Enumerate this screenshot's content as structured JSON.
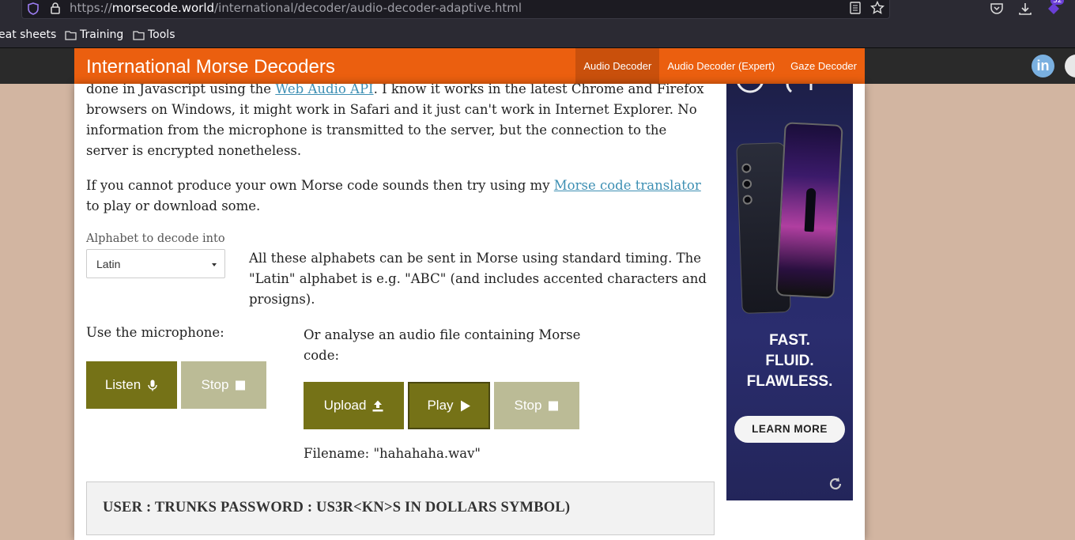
{
  "browser": {
    "url_prefix": "https://",
    "url_host": "morsecode.world",
    "url_path": "/international/decoder/audio-decoder-adaptive.html",
    "extensions_badge": "32",
    "bookmarks": [
      "eat sheets",
      "Training",
      "Tools"
    ]
  },
  "site": {
    "title": "International Morse Decoders",
    "nav": [
      "Audio Decoder",
      "Audio Decoder (Expert)",
      "Gaze Decoder"
    ],
    "social": {
      "linkedin": "in"
    }
  },
  "content": {
    "p1_before": "done in Javascript using the ",
    "p1_link": "Web Audio API",
    "p1_after": ". I know it works in the latest Chrome and Firefox browsers on Windows, it might work in Safari and it just can't work in Internet Explorer. No information from the microphone is transmitted to the server, but the connection to the server is encrypted nonetheless.",
    "p2_before": "If you cannot produce your own Morse code sounds then try using my ",
    "p2_link": "Morse code translator",
    "p2_after": " to play or download some.",
    "alphabet_label": "Alphabet to decode into",
    "alphabet_value": "Latin",
    "alphabet_desc": "All these alphabets can be sent in Morse using standard timing. The \"Latin\" alphabet is e.g. \"ABC\" (and includes accented characters and prosigns).",
    "mic_label": "Use the microphone:",
    "file_label": "Or analyse an audio file containing Morse code:",
    "listen_label": "Listen",
    "stop_label": "Stop",
    "upload_label": "Upload",
    "play_label": "Play",
    "filename": "Filename: \"hahahaha.wav\"",
    "output": "USER : TRUNKS PASSWORD : US3R<KN>S IN DOLLARS SYMBOL)"
  },
  "ad": {
    "tagline": [
      "FAST.",
      "FLUID.",
      "FLAWLESS."
    ],
    "cta": "LEARN MORE"
  },
  "colors": {
    "nav_orange": "#eb5f0f",
    "button_olive": "#757217",
    "button_olive_light": "#bbbb96",
    "link": "#3d8fb3"
  }
}
